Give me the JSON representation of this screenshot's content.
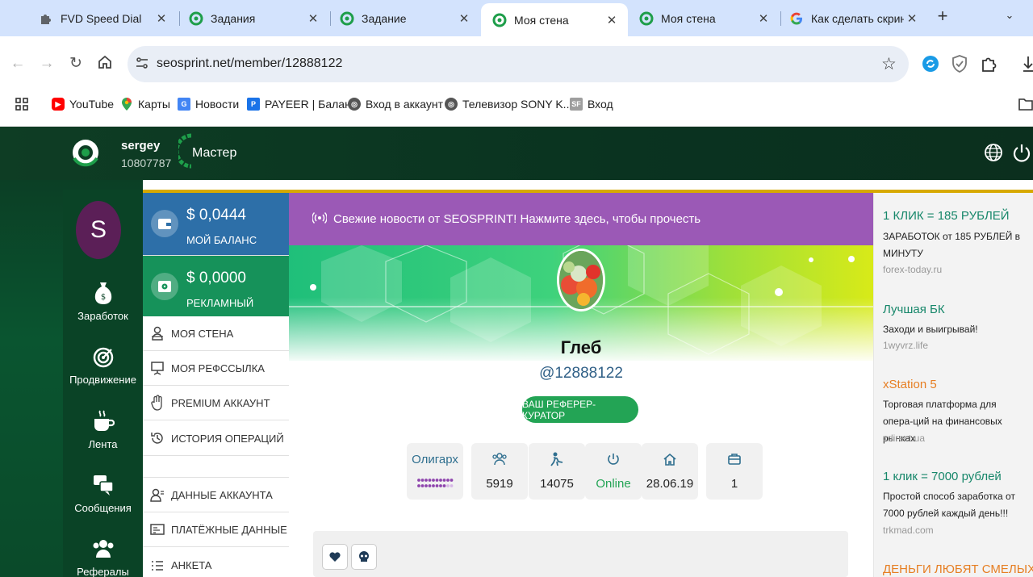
{
  "browser": {
    "tabs": [
      {
        "title": "FVD Speed Dial",
        "icon": "puzzle-icon"
      },
      {
        "title": "Задания",
        "icon": "seosprint-icon"
      },
      {
        "title": "Задание",
        "icon": "seosprint-icon"
      },
      {
        "title": "Моя стена",
        "icon": "seosprint-icon",
        "active": true
      },
      {
        "title": "Моя стена",
        "icon": "seosprint-icon"
      },
      {
        "title": "Как сделать скриншот",
        "icon": "google-icon"
      }
    ],
    "url": "seosprint.net/member/12888122",
    "bookmarks": [
      {
        "label": "YouTube",
        "color": "#ff0000"
      },
      {
        "label": "Карты",
        "color": "#34a853"
      },
      {
        "label": "Новости",
        "color": "#4285f4"
      },
      {
        "label": "PAYEER | Баланс",
        "color": "#1a73e8"
      },
      {
        "label": "Вход в аккаунт",
        "color": "#555555"
      },
      {
        "label": "Телевизор SONY K...",
        "color": "#555555"
      },
      {
        "label": "Вход",
        "color": "#9e9e9e"
      }
    ]
  },
  "header": {
    "username": "sergey",
    "user_id": "10807787",
    "level": "Мастер"
  },
  "sidebar": {
    "avatar_letter": "S",
    "items": [
      {
        "label": "Заработок",
        "icon": "money-bag-icon"
      },
      {
        "label": "Продвижение",
        "icon": "target-icon"
      },
      {
        "label": "Лента",
        "icon": "coffee-icon"
      },
      {
        "label": "Сообщения",
        "icon": "chat-icon"
      },
      {
        "label": "Рефералы",
        "icon": "users-icon"
      }
    ]
  },
  "balance": {
    "my_amount": "$ 0,0444",
    "my_label": "МОЙ БАЛАНС",
    "ad_amount": "$ 0,0000",
    "ad_label": "РЕКЛАМНЫЙ"
  },
  "menu": [
    {
      "label": "МОЯ СТЕНА",
      "icon": "wall-icon"
    },
    {
      "label": "МОЯ РЕФССЫЛКА",
      "icon": "presentation-icon"
    },
    {
      "label": "PREMIUM АККАУНТ",
      "icon": "hand-icon"
    },
    {
      "label": "ИСТОРИЯ ОПЕРАЦИЙ",
      "icon": "history-icon"
    },
    {
      "label": "ДАННЫЕ АККАУНТА",
      "icon": "user-data-icon"
    },
    {
      "label": "ПЛАТЁЖНЫЕ ДАННЫЕ",
      "icon": "card-icon"
    },
    {
      "label": "АНКЕТА",
      "icon": "list-icon"
    }
  ],
  "news": {
    "text": "Свежие новости от SEOSPRINT! Нажмите здесь, чтобы прочесть"
  },
  "profile": {
    "name": "Глеб",
    "handle": "@12888122",
    "referrer_button": "ВАШ РЕФЕРЕР-КУРАТОР",
    "stats": [
      {
        "value": "Олигарх",
        "icon": "rank-label",
        "color": "#2f6f8f"
      },
      {
        "value": "5919",
        "icon": "users-icon",
        "color": "#222222"
      },
      {
        "value": "14075",
        "icon": "worker-icon",
        "color": "#222222"
      },
      {
        "value": "Online",
        "icon": "power-icon",
        "color": "#23a455"
      },
      {
        "value": "28.06.19",
        "icon": "home-icon",
        "color": "#222222"
      },
      {
        "value": "1",
        "icon": "briefcase-icon",
        "color": "#222222"
      }
    ],
    "rank_dots_filled": 0.9
  },
  "ads": [
    {
      "title": "1 КЛИК = 185 РУБЛЕЙ",
      "text": "ЗАРАБОТОК от 185 РУБЛЕЙ в МИНУТУ",
      "url": "forex-today.ru",
      "color": "#17876a"
    },
    {
      "title": "Лучшая БК",
      "text": "Заходи и выигрывай!",
      "url": "1wyvrz.life",
      "color": "#17876a"
    },
    {
      "title": "xStation 5",
      "text": "Торговая платформа для опера-ций на финансовых рынках",
      "url": "xdirect.ua",
      "color": "#e67e22"
    },
    {
      "title": "1 клик = 7000 рублей",
      "text": "Простой способ заработка от 7000 рублей каждый день!!!",
      "url": "trkmad.com",
      "color": "#17876a"
    },
    {
      "title": "ДЕНЬГИ ЛЮБЯТ СМЕЛЫХ!",
      "color": "#e67e22"
    }
  ]
}
